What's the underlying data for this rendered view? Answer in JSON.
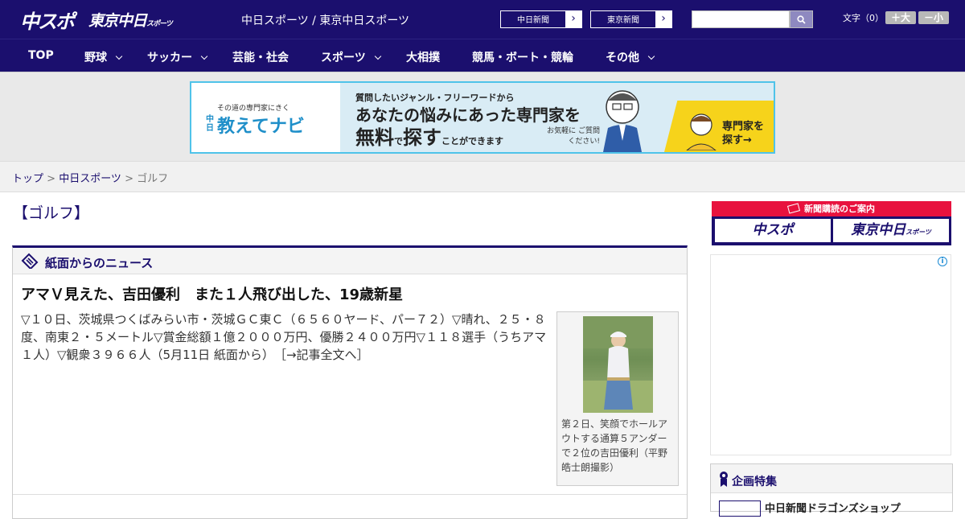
{
  "header": {
    "logo_chuspo": "中スポ",
    "logo_tokyo": "東京中日",
    "logo_tokyo_small": "スポーツ",
    "site_title": "中日スポーツ / 東京中日スポーツ",
    "btn_chunichi": "中日新聞",
    "btn_tokyo": "東京新聞",
    "search": {
      "value": "",
      "placeholder": ""
    },
    "font_label": "文字（0）",
    "font_bigger": "＋大",
    "font_smaller": "－小"
  },
  "nav": {
    "items": [
      {
        "label": "TOP",
        "has_dropdown": false
      },
      {
        "label": "野球",
        "has_dropdown": true
      },
      {
        "label": "サッカー",
        "has_dropdown": true
      },
      {
        "label": "芸能・社会",
        "has_dropdown": false
      },
      {
        "label": "スポーツ",
        "has_dropdown": true
      },
      {
        "label": "大相撲",
        "has_dropdown": false
      },
      {
        "label": "競馬・ボート・競輪",
        "has_dropdown": false
      },
      {
        "label": "その他",
        "has_dropdown": true
      }
    ]
  },
  "banner": {
    "subtitle": "その道の専門家にきく",
    "logo_prefix": "中日",
    "logo": "教えてナビ",
    "line1": "質問したいジャンル・フリーワードから",
    "line2": "あなたの悩みにあった専門家を",
    "line3_a": "無料",
    "line3_b": "で",
    "line3_c": "探す",
    "line3_d": "ことができます",
    "note": "お気軽に ご質問ください!",
    "cta": "専門家を 探す→"
  },
  "breadcrumb": {
    "home": "トップ",
    "sep1": " > ",
    "section": "中日スポーツ",
    "sep2": " > ",
    "current": "ゴルフ"
  },
  "page_heading": "【ゴルフ】",
  "news": {
    "section_title": "紙面からのニュース",
    "article_title": "アマＶ見えた、吉田優利　また１人飛び出した、19歳新星",
    "article_body": "▽１０日、茨城県つくばみらい市・茨城ＧＣ東Ｃ（６５６０ヤード、パー７２）▽晴れ、２５・８度、南東２・５メートル▽賞金総額１億２０００万円、優勝２４００万円▽１１８選手（うちアマ１人）▽観衆３９６６人（5月11日 紙面から）",
    "article_link": "［→記事全文へ］",
    "photo_caption": "第２日、笑顔でホールアウトする通算５アンダーで２位の吉田優利（平野皓士朗撮影）"
  },
  "sidebar": {
    "subscribe_head": "新聞購読のご案内",
    "subscribe_chuspo": "中スポ",
    "subscribe_tokyo": "東京中日",
    "subscribe_tokyo_small": "スポーツ",
    "ad_info_icon": "i",
    "special_title": "企画特集",
    "special_item": "中日新聞ドラゴンズショップ"
  },
  "colors": {
    "brand_navy": "#1b0f6e",
    "accent_red": "#e8123e",
    "banner_blue": "#4fc3e9",
    "banner_yellow": "#f6d31b"
  }
}
